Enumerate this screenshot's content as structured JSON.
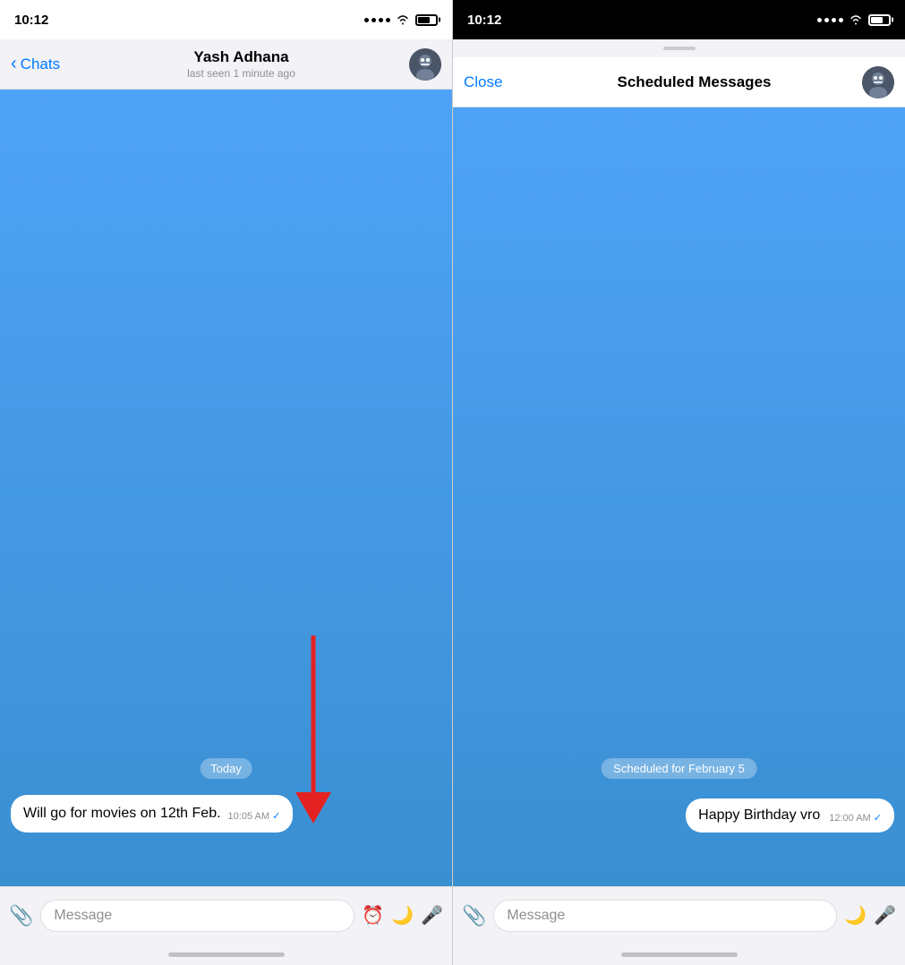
{
  "left_panel": {
    "status_time": "10:12",
    "nav": {
      "back_label": "Chats",
      "title": "Yash Adhana",
      "subtitle": "last seen 1 minute ago"
    },
    "date_label": "Today",
    "message": {
      "text": "Will go for movies on 12th Feb.",
      "time": "10:05 AM",
      "check": "✓"
    },
    "input": {
      "placeholder": "Message"
    }
  },
  "right_panel": {
    "status_time": "10:12",
    "nav": {
      "close_label": "Close",
      "title": "Scheduled Messages"
    },
    "scheduled_label": "Scheduled for February 5",
    "message": {
      "text": "Happy Birthday vro",
      "time": "12:00 AM",
      "check": "✓"
    },
    "input": {
      "placeholder": "Message"
    }
  }
}
